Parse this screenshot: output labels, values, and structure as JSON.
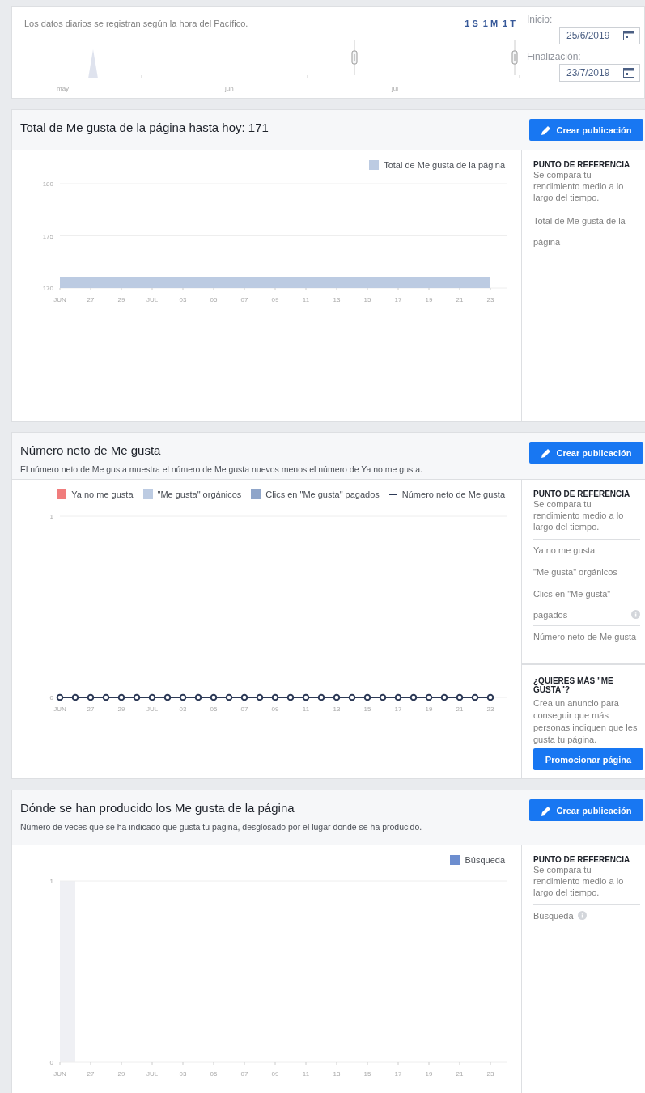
{
  "date_range": {
    "note": "Los datos diarios se registran según la hora del Pacífico.",
    "presets": [
      {
        "label": "1 S"
      },
      {
        "label": "1 M"
      },
      {
        "label": "1 T"
      }
    ],
    "timeline_months": [
      "may",
      "jun",
      "jul"
    ],
    "start": {
      "label": "Inicio:",
      "value": "25/6/2019"
    },
    "end": {
      "label": "Finalización:",
      "value": "23/7/2019"
    }
  },
  "sections": [
    {
      "title": "Total de Me gusta de la página hasta hoy: 171",
      "button": "Crear publicación",
      "chart_data": {
        "type": "area",
        "categories": [
          "JUN",
          null,
          "27",
          null,
          "29",
          null,
          "JUL",
          null,
          "03",
          null,
          "05",
          null,
          "07",
          null,
          "09",
          null,
          "11",
          null,
          "13",
          null,
          "15",
          null,
          "17",
          null,
          "19",
          null,
          "21",
          null,
          "23"
        ],
        "series": [
          {
            "name": "Total de Me gusta de la página",
            "color": "#bccbe2",
            "values": [
              171,
              171,
              171,
              171,
              171,
              171,
              171,
              171,
              171,
              171,
              171,
              171,
              171,
              171,
              171,
              171,
              171,
              171,
              171,
              171,
              171,
              171,
              171,
              171,
              171,
              171,
              171,
              171,
              171
            ]
          }
        ],
        "ylim": [
          170,
          180
        ],
        "yticks": [
          170,
          175,
          180
        ]
      },
      "benchmark": {
        "heading": "PUNTO DE REFERENCIA",
        "description": "Se compara tu rendimiento medio a lo largo del tiempo.",
        "items": [
          {
            "label": "Total de Me gusta de la página",
            "info": false
          }
        ]
      }
    },
    {
      "title": "Número neto de Me gusta",
      "subtitle": "El número neto de Me gusta muestra el número de Me gusta nuevos menos el número de Ya no me gusta.",
      "button": "Crear publicación",
      "chart_data": {
        "type": "bar",
        "categories": [
          "JUN",
          null,
          "27",
          null,
          "29",
          null,
          "JUL",
          null,
          "03",
          null,
          "05",
          null,
          "07",
          null,
          "09",
          null,
          "11",
          null,
          "13",
          null,
          "15",
          null,
          "17",
          null,
          "19",
          null,
          "21",
          null,
          "23"
        ],
        "series": [
          {
            "name": "Ya no me gusta",
            "color": "#f07c7c",
            "values": [
              0,
              0,
              0,
              0,
              0,
              0,
              0,
              0,
              0,
              0,
              0,
              0,
              0,
              0,
              0,
              0,
              0,
              0,
              0,
              0,
              0,
              0,
              0,
              0,
              0,
              0,
              0,
              0,
              0
            ]
          },
          {
            "name": "\"Me gusta\" orgánicos",
            "color": "#bccbe2",
            "values": [
              0,
              0,
              0,
              0,
              0,
              0,
              0,
              0,
              0,
              0,
              0,
              0,
              0,
              0,
              0,
              0,
              0,
              0,
              0,
              0,
              0,
              0,
              0,
              0,
              0,
              0,
              0,
              0,
              0
            ]
          },
          {
            "name": "Clics en \"Me gusta\" pagados",
            "color": "#8fa5c9",
            "values": [
              0,
              0,
              0,
              0,
              0,
              0,
              0,
              0,
              0,
              0,
              0,
              0,
              0,
              0,
              0,
              0,
              0,
              0,
              0,
              0,
              0,
              0,
              0,
              0,
              0,
              0,
              0,
              0,
              0
            ]
          },
          {
            "name": "Número neto de Me gusta",
            "color": "#2d3a57",
            "type": "line",
            "marker": "o",
            "values": [
              0,
              0,
              0,
              0,
              0,
              0,
              0,
              0,
              0,
              0,
              0,
              0,
              0,
              0,
              0,
              0,
              0,
              0,
              0,
              0,
              0,
              0,
              0,
              0,
              0,
              0,
              0,
              0,
              0
            ]
          }
        ],
        "ylim": [
          0,
          1
        ],
        "yticks": [
          0,
          1
        ]
      },
      "benchmark": {
        "heading": "PUNTO DE REFERENCIA",
        "description": "Se compara tu rendimiento medio a lo largo del tiempo.",
        "items": [
          {
            "label": "Ya no me gusta",
            "info": false
          },
          {
            "label": "\"Me gusta\" orgánicos",
            "info": false
          },
          {
            "label": "Clics en \"Me gusta\" pagados",
            "info": true
          },
          {
            "label": "Número neto de Me gusta",
            "info": false
          }
        ]
      },
      "promo": {
        "heading": "¿QUIERES MÁS \"ME GUSTA\"?",
        "text": "Crea un anuncio para conseguir que más personas indiquen que les gusta tu página.",
        "button": "Promocionar página"
      }
    },
    {
      "title": "Dónde se han producido los Me gusta de la página",
      "subtitle": "Número de veces que se ha indicado que gusta tu página, desglosado por el lugar donde se ha producido.",
      "button": "Crear publicación",
      "chart_data": {
        "type": "bar",
        "categories": [
          "JUN",
          null,
          "27",
          null,
          "29",
          null,
          "JUL",
          null,
          "03",
          null,
          "05",
          null,
          "07",
          null,
          "09",
          null,
          "11",
          null,
          "13",
          null,
          "15",
          null,
          "17",
          null,
          "19",
          null,
          "21",
          null,
          "23"
        ],
        "series": [
          {
            "name": "Búsqueda",
            "color": "#6d8ecf",
            "values": [
              0,
              0,
              0,
              0,
              0,
              0,
              0,
              0,
              0,
              0,
              0,
              0,
              0,
              0,
              0,
              0,
              0,
              0,
              0,
              0,
              0,
              0,
              0,
              0,
              0,
              0,
              0,
              0,
              0
            ]
          }
        ],
        "ylim": [
          0,
          1
        ],
        "yticks": [
          0,
          1
        ]
      },
      "first_day_highlighted": true,
      "benchmark": {
        "heading": "PUNTO DE REFERENCIA",
        "description": "Se compara tu rendimiento medio a lo largo del tiempo.",
        "items": [
          {
            "label": "Búsqueda",
            "info": true
          }
        ]
      }
    }
  ]
}
